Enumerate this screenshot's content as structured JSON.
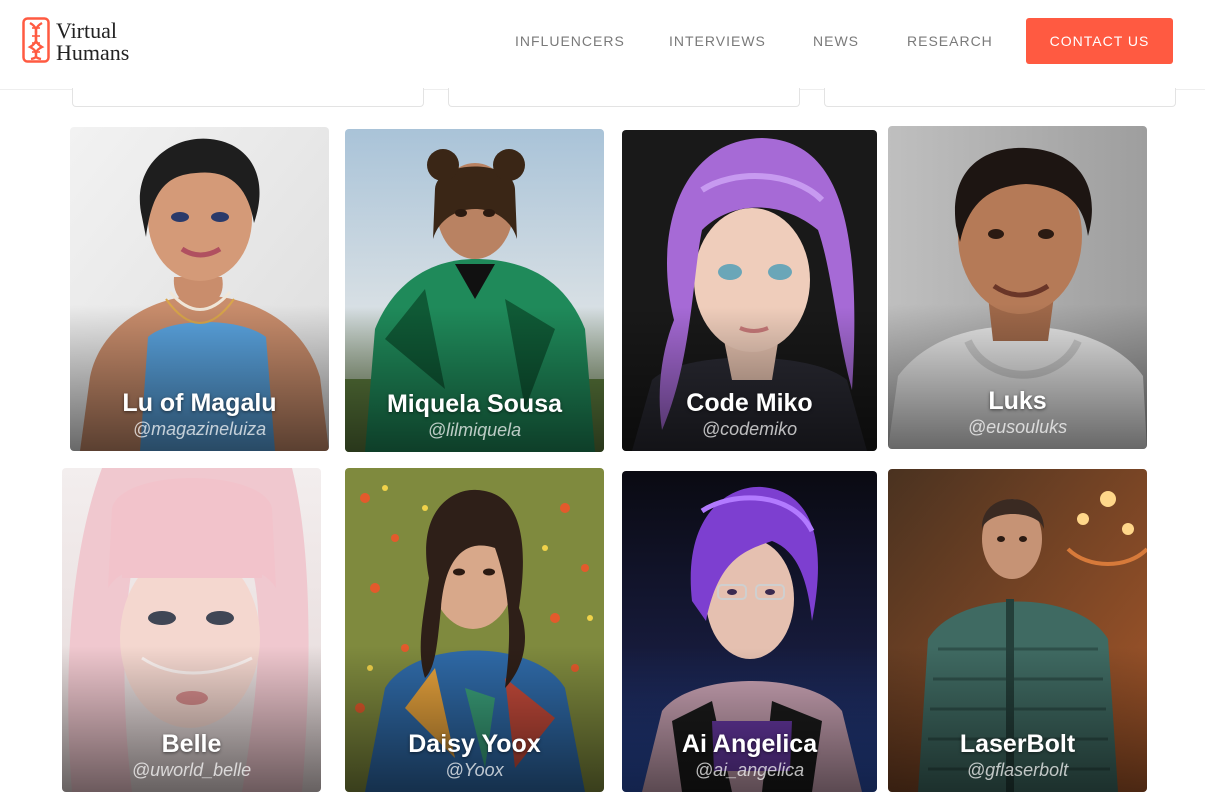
{
  "brand": {
    "name_line1": "Virtual",
    "name_line2": "Humans",
    "accent": "#ff5a41"
  },
  "nav": {
    "items": [
      "INFLUENCERS",
      "INTERVIEWS",
      "NEWS",
      "RESEARCH"
    ],
    "contact_label": "CONTACT US"
  },
  "influencers": [
    {
      "name": "Lu of Magalu",
      "handle": "@magazineluiza"
    },
    {
      "name": "Miquela Sousa",
      "handle": "@lilmiquela"
    },
    {
      "name": "Code Miko",
      "handle": "@codemiko"
    },
    {
      "name": "Luks",
      "handle": "@eusouluks"
    },
    {
      "name": "Belle",
      "handle": "@uworld_belle"
    },
    {
      "name": "Daisy Yoox",
      "handle": "@Yoox"
    },
    {
      "name": "Ai Angelica",
      "handle": "@ai_angelica"
    },
    {
      "name": "LaserBolt",
      "handle": "@gflaserbolt"
    }
  ]
}
